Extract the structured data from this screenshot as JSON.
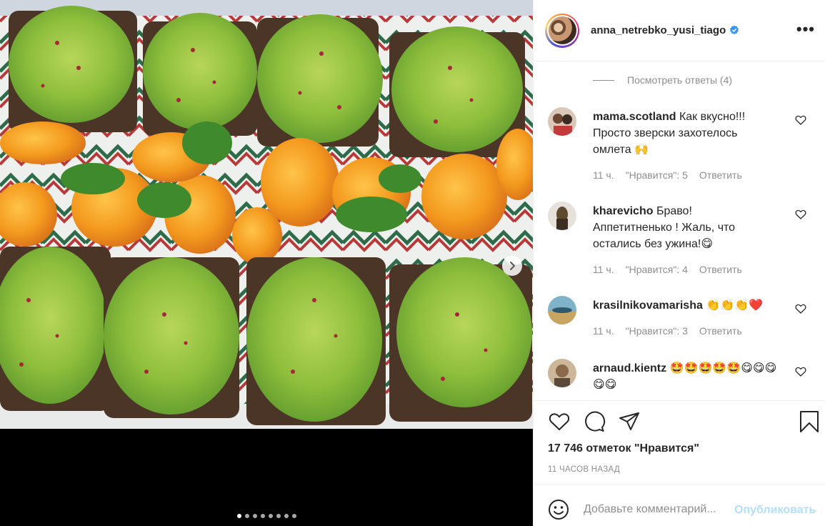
{
  "post": {
    "username": "anna_netrebko_yusi_tiago",
    "verified": true,
    "more_label": "•••"
  },
  "comments": {
    "view_replies": "Посмотреть ответы (4)",
    "items": [
      {
        "user": "mama.scotland",
        "text": "Как вкусно!!!Просто зверски захотелось омлета",
        "emoji": "🙌",
        "time": "11 ч.",
        "likes": "\"Нравится\": 5",
        "reply": "Ответить"
      },
      {
        "user": "kharevicho",
        "text": "Браво! Аппетитненько ! Жаль, что остались без ужина!",
        "emoji": "😋",
        "time": "11 ч.",
        "likes": "\"Нравится\": 4",
        "reply": "Ответить"
      },
      {
        "user": "krasilnikovamarisha",
        "text": "",
        "emoji": "👏👏👏❤️",
        "time": "11 ч.",
        "likes": "\"Нравится\": 3",
        "reply": "Ответить"
      },
      {
        "user": "arnaud.kientz",
        "text": "",
        "emoji": "🤩🤩🤩🤩🤩😋😋😋😋😋",
        "time": "",
        "likes": "",
        "reply": ""
      }
    ]
  },
  "actions": {
    "likes_count": "17 746 отметок \"Нравится\"",
    "time_ago": "11 ЧАСОВ НАЗАД"
  },
  "comment_box": {
    "placeholder": "Добавьте комментарий...",
    "publish_label": "Опубликовать"
  },
  "carousel": {
    "total": 8,
    "active_index": 0
  },
  "colors": {
    "link_blue_disabled": "#b2dffc",
    "verified_blue": "#3897f0",
    "text_secondary": "#8e8e8e",
    "like_red": "#ed4956"
  }
}
